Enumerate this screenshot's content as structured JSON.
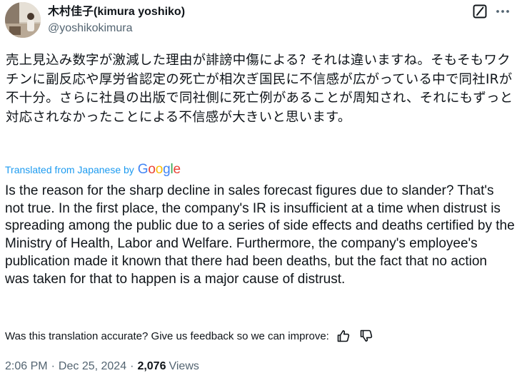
{
  "author": {
    "display_name": "木村佳子(kimura yoshiko)",
    "handle": "@yoshikokimura"
  },
  "icons": {
    "grok": "grok-icon",
    "more": "more-horizontal-icon",
    "thumbs_up": "thumbs-up-icon",
    "thumbs_down": "thumbs-down-icon"
  },
  "tweet": {
    "original_text": "売上見込み数字が激減した理由が誹謗中傷による? それは違いますね。そもそもワクチンに副反応や厚労省認定の死亡が相次ぎ国民に不信感が広がっている中で同社IRが不十分。さらに社員の出版で同社側に死亡例があることが周知され、それにもずっと対応されなかったことによる不信感が大きいと思います。",
    "translated_from": "Translated from Japanese by",
    "translator_logo": "Google",
    "translation_text": "Is the reason for the sharp decline in sales forecast figures due to slander? That's not true. In the first place, the company's IR is insufficient at a time when distrust is spreading among the public due to a series of side effects and deaths certified by the Ministry of Health, Labor and Welfare. Furthermore, the company's employee's publication made it known that there had been deaths, but the fact that no action was taken for that to happen is a major cause of distrust.",
    "feedback_question": "Was this translation accurate? Give us feedback so we can improve:"
  },
  "meta": {
    "time": "2:06 PM",
    "separator": "·",
    "date": "Dec 25, 2024",
    "views_count": "2,076",
    "views_label": "Views"
  },
  "colors": {
    "text": "#0f1419",
    "secondary": "#536471",
    "link": "#1d9bf0",
    "google_blue": "#4285f4",
    "google_red": "#ea4335",
    "google_yellow": "#fbbc05",
    "google_green": "#34a853"
  }
}
